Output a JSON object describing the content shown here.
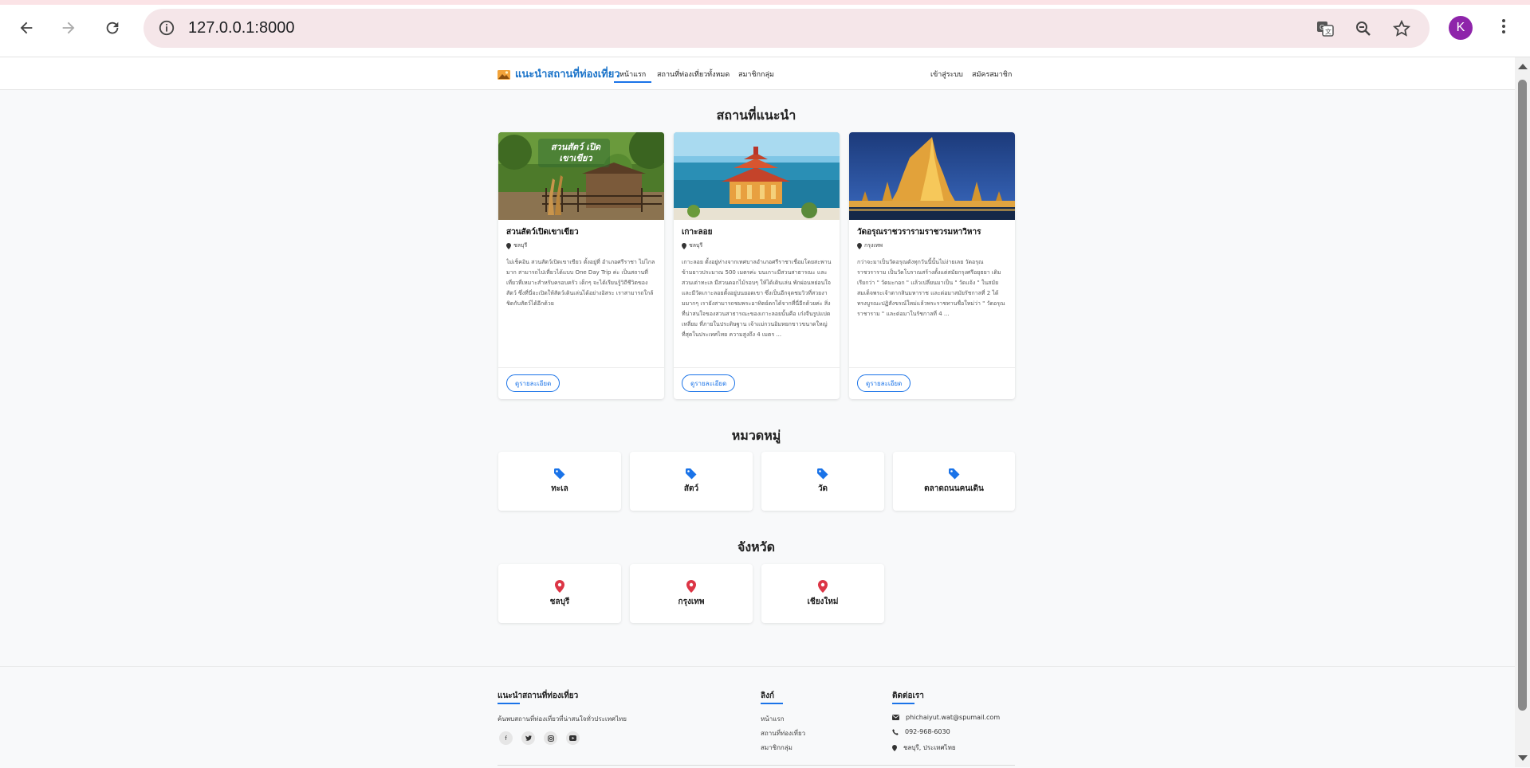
{
  "browser": {
    "url": "127.0.0.1:8000",
    "profile_initial": "K",
    "icons": [
      "back-icon",
      "forward-icon",
      "reload-icon",
      "info-icon",
      "translate-icon",
      "zoom-icon",
      "star-icon",
      "menu-icon"
    ]
  },
  "navbar": {
    "brand": "แนะนำสถานที่ท่องเที่ยว",
    "links": [
      "หน้าแรก",
      "สถานที่ท่องเที่ยวทั้งหมด",
      "สมาชิกกลุ่ม"
    ],
    "login": "เข้าสู่ระบบ",
    "register": "สมัครสมาชิก"
  },
  "recommended": {
    "title": "สถานที่แนะนำ",
    "cards": [
      {
        "name": "สวนสัตว์เปิดเขาเขียว",
        "province": "ชลบุรี",
        "image_text": "สวนสัตว์ เปิดเขาเขียว",
        "description": "ไม่เช็คอิน สวนสัตว์เปิดเขาเขียว ตั้งอยู่ที่ อำเภอศรีราชา ไม่ไกลมาก สามารถไปเที่ยวได้แบบ One Day Trip ค่ะ เป็นสถานที่เที่ยวที่เหมาะสำหรับครอบครัว เด็กๆ จะได้เรียนรู้วิถีชีวิตของสัตว์ ซึ่งที่นี่จะเปิดให้สัตว์เดินเล่นได้อย่างอิสระ เราสามารถใกล้ชิดกับสัตว์ได้อีกด้วย",
        "button": "ดูรายละเอียด"
      },
      {
        "name": "เกาะลอย",
        "province": "ชลบุรี",
        "description": "เกาะลอย ตั้งอยู่ห่างจากเทศบาลอำเภอศรีราชาเชื่อมโดยสะพานข้ามยาวประมาณ 500 เมตรค่ะ บนเกาะมีสวนสาธารณะ และสวนเต่าทะเล มีสวนดอกไม้รอบๆ ให้ได้เดินเล่น พักผ่อนหย่อนใจ และมีวัดเกาะลอยตั้งอยู่บนยอดเขา ซึ่งเป็นอีกจุดชมวิวที่สวยงามมากๆ เรายังสามารถชมพระอาทิตย์ตกได้จากที่นี่อีกด้วยค่ะ สิ่งที่น่าสนใจของสวนสาธารณะของเกาะลอยนั้นคือ เก๋งจีนรูปแปดเหลี่ยม ที่ภายในประดิษฐาน เจ้าแม่กวนอิมหยกขาวขนาดใหญ่ที่สุดในประเทศไทย ความสูงถึง 4 เมตร ...",
        "button": "ดูรายละเอียด"
      },
      {
        "name": "วัดอรุณราชวรารามราชวรมหาวิหาร",
        "province": "กรุงเทพ",
        "description": "กว่าจะมาเป็นวัดอรุณดังทุกวันนี้นั้นไม่ง่ายเลย วัดอรุณราชวราราม เป็นวัดโบราณสร้างตั้งแต่สมัยกรุงศรีอยุธยา เดิมเรียกว่า \" วัดมะกอก \" แล้วเปลี่ยนมาเป็น \" วัดแจ้ง \" ในสมัยสมเด็จพระเจ้าตากสินมหาราช และต่อมาสมัยรัชกาลที่ 2 ได้ทรงบูรณะปฏิสังขรณ์ใหม่แล้วพระราชทานชื่อใหม่ว่า \" วัดอรุณราชาราม \" และต่อมาในรัชกาลที่ 4 ...",
        "button": "ดูรายละเอียด"
      }
    ]
  },
  "categories": {
    "title": "หมวดหมู่",
    "items": [
      "ทะเล",
      "สัตว์",
      "วัด",
      "ตลาดถนนคนเดิน"
    ],
    "icon": "tag-icon",
    "icon_color": "#1a73e8"
  },
  "provinces": {
    "title": "จังหวัด",
    "items": [
      "ชลบุรี",
      "กรุงเทพ",
      "เชียงใหม่"
    ],
    "icon": "map-pin-icon",
    "icon_color": "#dc3545"
  },
  "footer": {
    "about_title": "แนะนำสถานที่ท่องเที่ยว",
    "about_text": "ค้นพบสถานที่ท่องเที่ยวที่น่าสนใจทั่วประเทศไทย",
    "social": [
      "facebook-icon",
      "twitter-icon",
      "instagram-icon",
      "youtube-icon"
    ],
    "links_title": "ลิงก์",
    "links": [
      "หน้าแรก",
      "สถานที่ท่องเที่ยว",
      "สมาชิกกลุ่ม"
    ],
    "contact_title": "ติดต่อเรา",
    "email": "phichaiyut.wat@spumail.com",
    "phone": "092-968-6030",
    "address": "ชลบุรี, ประเทศไทย"
  },
  "colors": {
    "brand": "#1a73c9",
    "accent": "#1a73e8",
    "danger": "#dc3545"
  }
}
